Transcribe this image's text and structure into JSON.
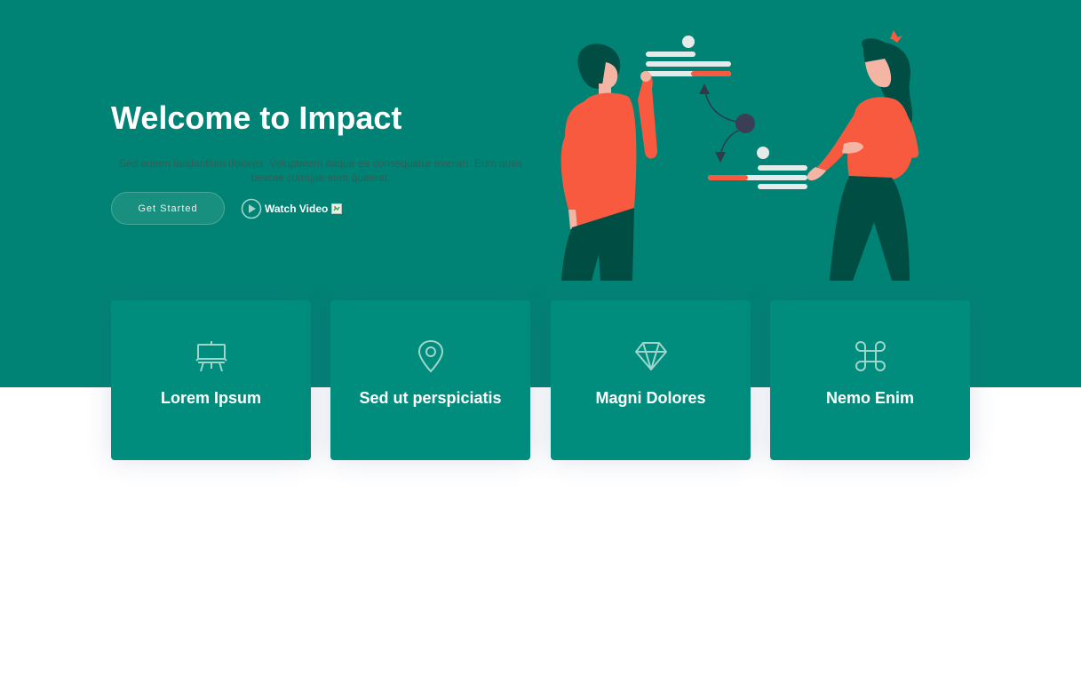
{
  "hero": {
    "title": "Welcome to Impact",
    "text": "Sed autem laudantium dolores. Voluptatem itaque ea consequatur eveniet. Eum quas beatae cumque eum quaerat.",
    "cta_label": "Get Started",
    "video_label": "Watch Video",
    "illustration_icon": "people-presenting-illustration"
  },
  "cards": [
    {
      "icon": "easel-icon",
      "title": "Lorem Ipsum"
    },
    {
      "icon": "geo-pin-icon",
      "title": "Sed ut perspiciatis"
    },
    {
      "icon": "gem-icon",
      "title": "Magni Dolores"
    },
    {
      "icon": "command-icon",
      "title": "Nemo Enim"
    }
  ],
  "colors": {
    "hero_bg": "#008374",
    "card_bg": "#008d7d",
    "accent": "#f85a40",
    "dark_figure": "#004d43",
    "icon_stroke": "#9fd6cc"
  }
}
